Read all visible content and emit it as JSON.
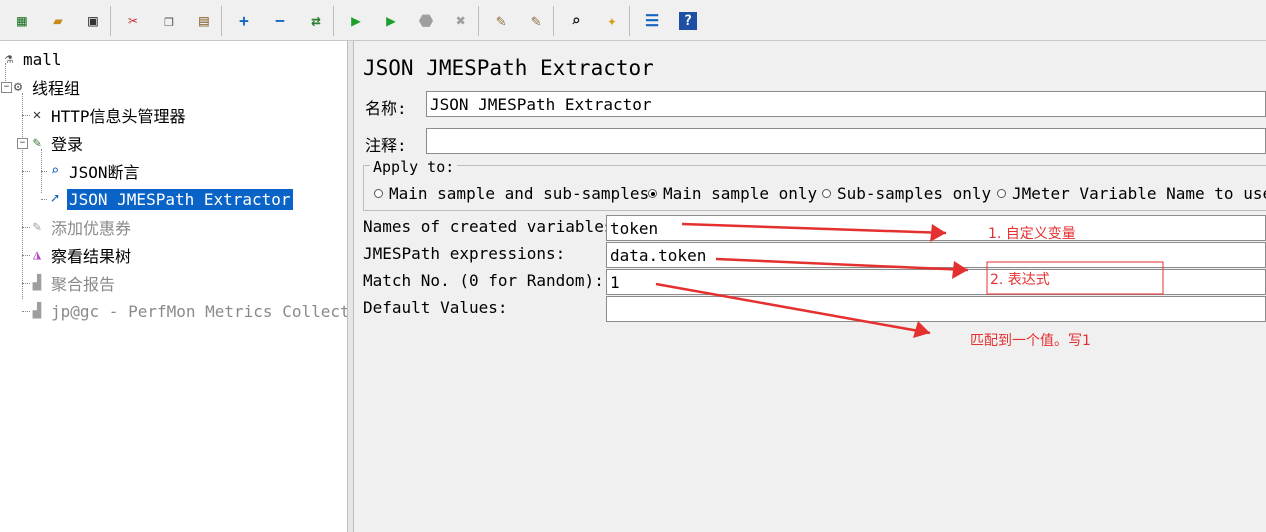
{
  "toolbar": {
    "buttons": [
      {
        "name": "templates-button",
        "icon": "templates-icon",
        "glyph": "▦",
        "color": "#2e7d32"
      },
      {
        "name": "open-button",
        "icon": "folder-open-icon",
        "glyph": "▰",
        "color": "#c78a1a"
      },
      {
        "name": "save-button",
        "icon": "save-icon",
        "glyph": "▣",
        "color": "#333333"
      },
      {
        "name": "cut-button",
        "icon": "cut-icon",
        "glyph": "✂",
        "color": "#c62828"
      },
      {
        "name": "copy-button",
        "icon": "copy-icon",
        "glyph": "❐",
        "color": "#555555"
      },
      {
        "name": "paste-button",
        "icon": "paste-icon",
        "glyph": "▤",
        "color": "#8d6e3a"
      },
      {
        "name": "expand-all-button",
        "icon": "plus-icon",
        "glyph": "+",
        "color": "#1565c0"
      },
      {
        "name": "collapse-all-button",
        "icon": "minus-icon",
        "glyph": "−",
        "color": "#1565c0"
      },
      {
        "name": "toggle-button",
        "icon": "toggle-icon",
        "glyph": "⇄",
        "color": "#2e7d32"
      },
      {
        "name": "start-button",
        "icon": "play-icon",
        "glyph": "▶",
        "color": "#1b9e2a"
      },
      {
        "name": "start-no-pause-button",
        "icon": "play-no-timers-icon",
        "glyph": "▶",
        "color": "#1b9e2a"
      },
      {
        "name": "stop-button",
        "icon": "stop-icon",
        "glyph": "⬣",
        "color": "#9e9e9e"
      },
      {
        "name": "shutdown-button",
        "icon": "shutdown-icon",
        "glyph": "✖",
        "color": "#9e9e9e"
      },
      {
        "name": "clear-button",
        "icon": "broom-clear-icon",
        "glyph": "✎",
        "color": "#8d6e3a"
      },
      {
        "name": "clear-all-button",
        "icon": "broom-clear-all-icon",
        "glyph": "✎",
        "color": "#8d6e3a"
      },
      {
        "name": "search-button",
        "icon": "binoculars-icon",
        "glyph": "⌕",
        "color": "#222222"
      },
      {
        "name": "reset-search-button",
        "icon": "broom-icon",
        "glyph": "✦",
        "color": "#d4a017"
      },
      {
        "name": "function-helper-button",
        "icon": "list-icon",
        "glyph": "☰",
        "color": "#1565c0"
      },
      {
        "name": "help-button",
        "icon": "help-icon",
        "glyph": "?",
        "color": "#ffffff"
      }
    ]
  },
  "tree": {
    "nodes": [
      {
        "label": "mall",
        "icon": "test-plan-icon",
        "glyph": "⚗",
        "iconColor": "#555555",
        "state": "normal"
      },
      {
        "label": "线程组",
        "icon": "gear-icon",
        "glyph": "⚙",
        "iconColor": "#555555",
        "state": "normal"
      },
      {
        "label": "HTTP信息头管理器",
        "icon": "tools-icon",
        "glyph": "✕",
        "iconColor": "#333333",
        "state": "normal"
      },
      {
        "label": "登录",
        "icon": "sampler-pen-icon",
        "glyph": "✎",
        "iconColor": "#3b7a3b",
        "state": "normal"
      },
      {
        "label": "JSON断言",
        "icon": "magnifier-icon",
        "glyph": "⌕",
        "iconColor": "#1565c0",
        "state": "normal"
      },
      {
        "label": "JSON JMESPath Extractor",
        "icon": "extractor-icon",
        "glyph": "➚",
        "iconColor": "#1565c0",
        "state": "selected"
      },
      {
        "label": "添加优惠券",
        "icon": "sampler-pen-icon",
        "glyph": "✎",
        "iconColor": "#9e9e9e",
        "state": "disabled"
      },
      {
        "label": "察看结果树",
        "icon": "chart-icon",
        "glyph": "◮",
        "iconColor": "#b14dbf",
        "state": "normal"
      },
      {
        "label": "聚合报告",
        "icon": "report-icon",
        "glyph": "▟",
        "iconColor": "#9e9e9e",
        "state": "disabled"
      },
      {
        "label": "jp@gc - PerfMon Metrics Collector",
        "icon": "report-icon",
        "glyph": "▟",
        "iconColor": "#9e9e9e",
        "state": "disabled"
      }
    ]
  },
  "panel": {
    "title": "JSON JMESPath Extractor",
    "name_label": "名称:",
    "name_value": "JSON JMESPath Extractor",
    "comment_label": "注释:",
    "comment_value": "",
    "apply_to": {
      "legend": "Apply to:",
      "options": [
        {
          "label": "Main sample and sub-samples",
          "selected": false
        },
        {
          "label": "Main sample only",
          "selected": true
        },
        {
          "label": "Sub-samples only",
          "selected": false
        },
        {
          "label": "JMeter Variable Name to use",
          "selected": false
        }
      ]
    },
    "fields": [
      {
        "label": "Names of created variables:",
        "value": "token"
      },
      {
        "label": "JMESPath expressions:",
        "value": "data.token"
      },
      {
        "label": "Match No. (0 for Random):",
        "value": "1"
      },
      {
        "label": "Default Values:",
        "value": ""
      }
    ]
  },
  "annotations": {
    "note1": "1. 自定义变量",
    "note2": "2. 表达式",
    "note3": "匹配到一个值。写1",
    "color": "#e53030"
  }
}
